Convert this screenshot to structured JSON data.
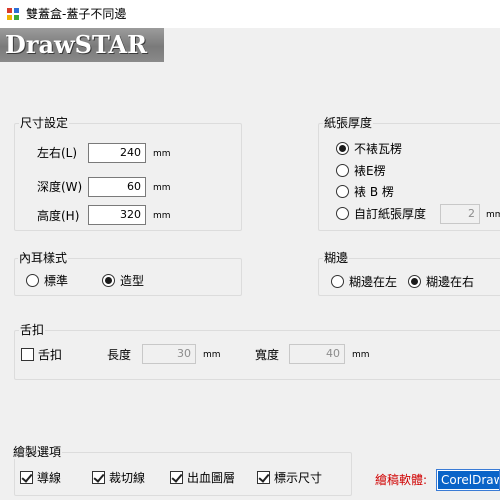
{
  "window": {
    "title": "雙蓋盒-蓋子不同邊"
  },
  "logo": {
    "text": "DrawSTAR"
  },
  "size_group": {
    "title": "尺寸設定",
    "fields": [
      {
        "label": "左右(L)",
        "value": "240",
        "unit": "mm"
      },
      {
        "label": "深度(W)",
        "value": "60",
        "unit": "mm"
      },
      {
        "label": "高度(H)",
        "value": "320",
        "unit": "mm"
      }
    ]
  },
  "paper_group": {
    "title": "紙張厚度",
    "options": [
      {
        "label": "不裱瓦楞",
        "checked": true
      },
      {
        "label": "裱E楞",
        "checked": false
      },
      {
        "label": "裱 B 楞",
        "checked": false
      },
      {
        "label": "自訂紙張厚度",
        "checked": false
      }
    ],
    "custom_value": "2",
    "custom_unit": "mm"
  },
  "ear_group": {
    "title": "內耳樣式",
    "options": [
      {
        "label": "標準",
        "checked": false
      },
      {
        "label": "造型",
        "checked": true
      }
    ]
  },
  "edge_group": {
    "title": "糊邊",
    "options": [
      {
        "label": "糊邊在左",
        "checked": false
      },
      {
        "label": "糊邊在右",
        "checked": true
      }
    ]
  },
  "tuck_group": {
    "title": "舌扣",
    "checkbox_label": "舌扣",
    "length_label": "長度",
    "length_value": "30",
    "length_unit": "mm",
    "width_label": "寬度",
    "width_value": "40",
    "width_unit": "mm"
  },
  "draw_group": {
    "title": "繪製選項",
    "options": [
      {
        "label": "導線",
        "checked": true
      },
      {
        "label": "裁切線",
        "checked": true
      },
      {
        "label": "出血圖層",
        "checked": true
      },
      {
        "label": "標示尺寸",
        "checked": true
      }
    ]
  },
  "software": {
    "label": "繪稿軟體:",
    "selected": "CorelDraw"
  },
  "colors": {
    "accent": "#0a64c8",
    "software_label": "#d00000"
  }
}
